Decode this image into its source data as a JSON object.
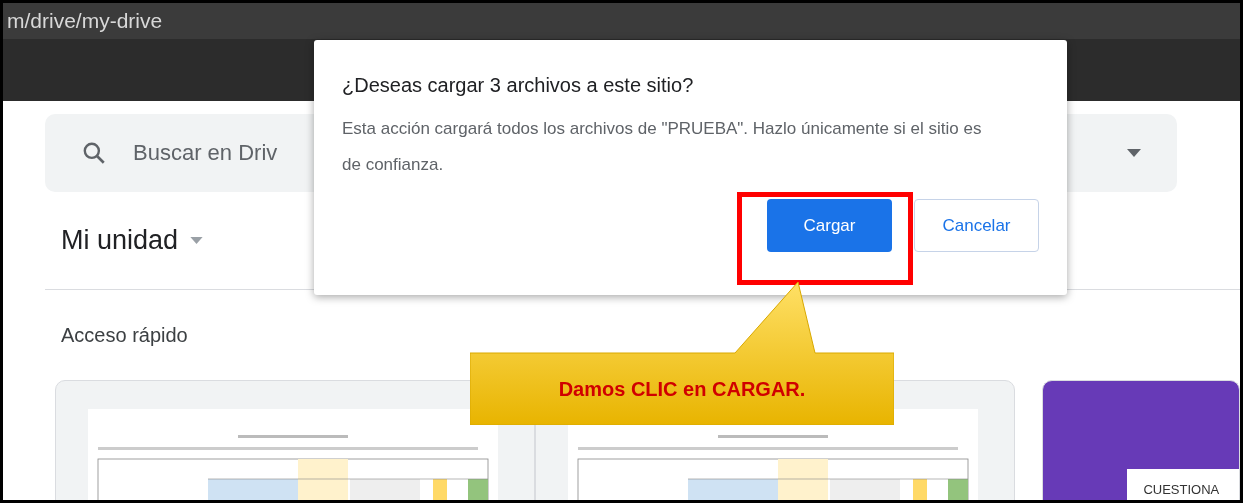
{
  "address_bar": {
    "url": "m/drive/my-drive"
  },
  "search": {
    "placeholder": "Buscar en Driv"
  },
  "page": {
    "title": "Mi unidad",
    "section": "Acceso rápido"
  },
  "cards": [
    {
      "kind": "document"
    },
    {
      "kind": "document"
    },
    {
      "kind": "form",
      "label": "CUESTIONA"
    }
  ],
  "dialog": {
    "title": "¿Deseas cargar 3 archivos a este sitio?",
    "message": "Esta acción cargará todos los archivos de \"PRUEBA\". Hazlo únicamente si el sitio es de confianza.",
    "buttons": [
      {
        "label": "Cargar",
        "primary": true
      },
      {
        "label": "Cancelar",
        "primary": false
      }
    ]
  },
  "annotation": {
    "text": "Damos CLIC en CARGAR."
  }
}
